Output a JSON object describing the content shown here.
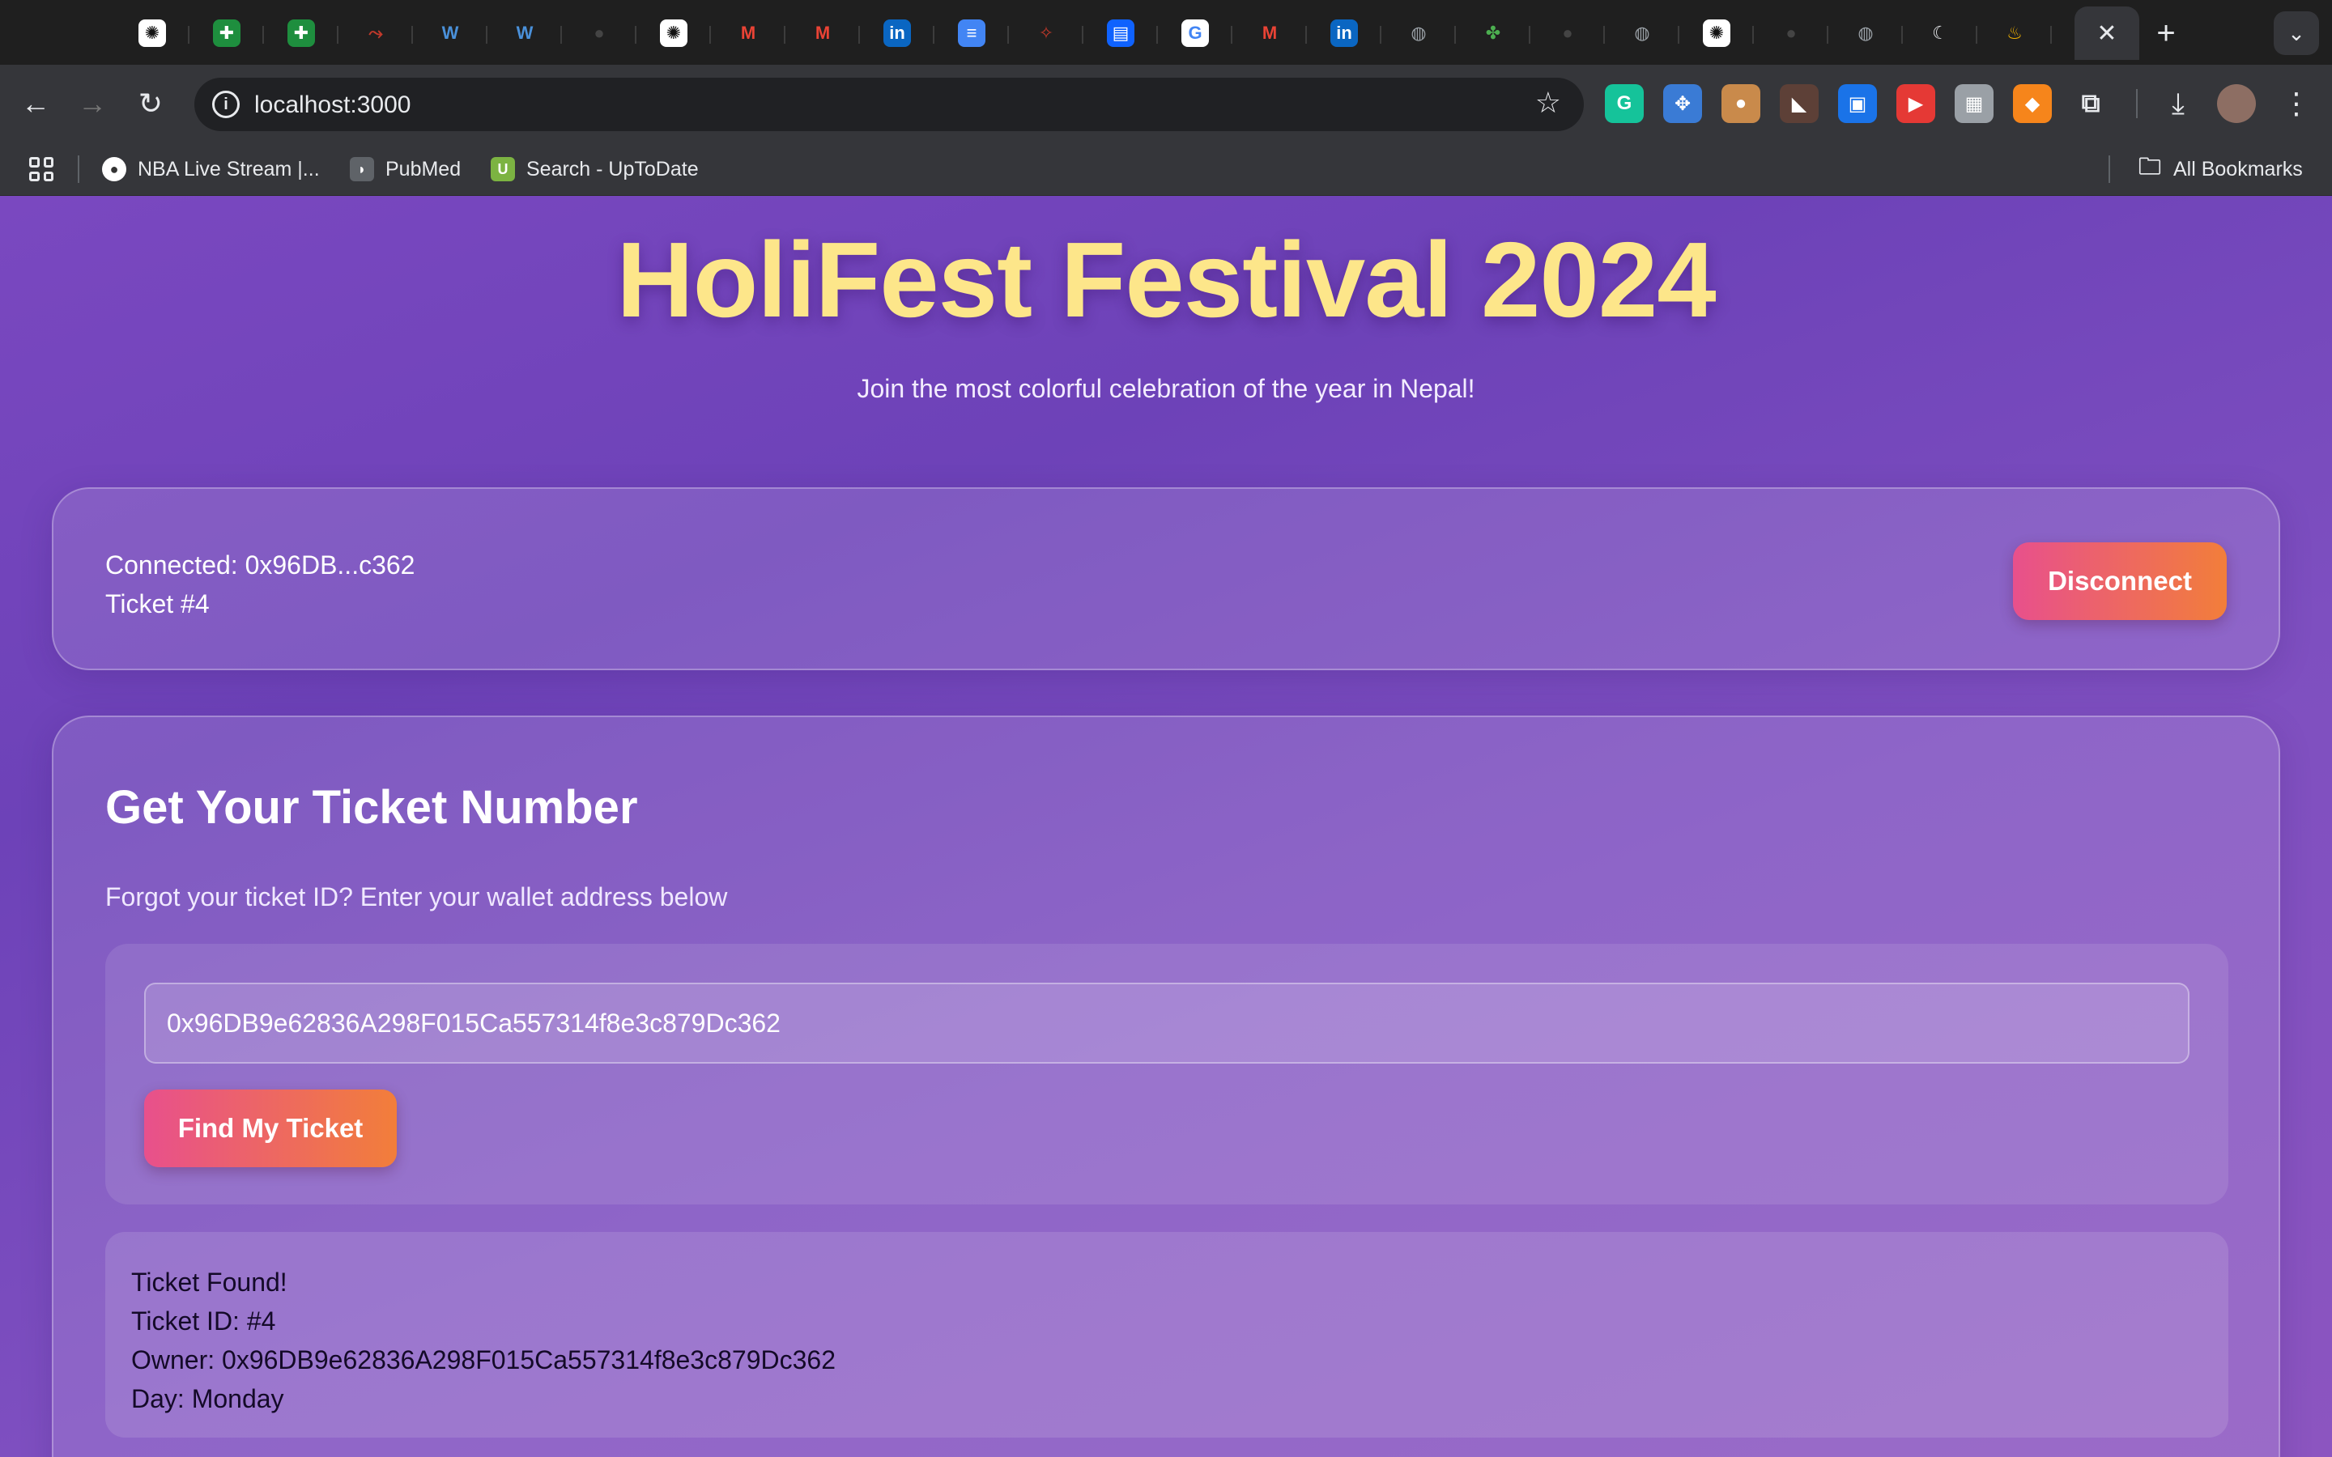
{
  "browser": {
    "tabs": [
      {
        "icon": "chatgpt-icon",
        "glyph": "✺",
        "bg": "#ffffff",
        "fg": "#111"
      },
      {
        "icon": "sheets-icon",
        "glyph": "✚",
        "bg": "#1e8e3e",
        "fg": "#fff"
      },
      {
        "icon": "sheets-icon",
        "glyph": "✚",
        "bg": "#1e8e3e",
        "fg": "#fff"
      },
      {
        "icon": "arrow-icon",
        "glyph": "⤳",
        "bg": "transparent",
        "fg": "#c0392b"
      },
      {
        "icon": "w-icon",
        "glyph": "W",
        "bg": "transparent",
        "fg": "#4a90d9"
      },
      {
        "icon": "w-icon",
        "glyph": "W",
        "bg": "transparent",
        "fg": "#4a90d9"
      },
      {
        "icon": "github-icon",
        "glyph": "●",
        "bg": "transparent",
        "fg": "#444"
      },
      {
        "icon": "chatgpt-icon",
        "glyph": "✺",
        "bg": "#ffffff",
        "fg": "#111"
      },
      {
        "icon": "gmail-icon",
        "glyph": "M",
        "bg": "transparent",
        "fg": "#ea4335"
      },
      {
        "icon": "gmail-icon",
        "glyph": "M",
        "bg": "transparent",
        "fg": "#ea4335"
      },
      {
        "icon": "linkedin-icon",
        "glyph": "in",
        "bg": "#0a66c2",
        "fg": "#fff"
      },
      {
        "icon": "docs-icon",
        "glyph": "≡",
        "bg": "#4285f4",
        "fg": "#fff"
      },
      {
        "icon": "red-logo-icon",
        "glyph": "✧",
        "bg": "transparent",
        "fg": "#c0392b"
      },
      {
        "icon": "ibm-icon",
        "glyph": "▤",
        "bg": "#0f62fe",
        "fg": "#fff"
      },
      {
        "icon": "google-icon",
        "glyph": "G",
        "bg": "#ffffff",
        "fg": "#4285f4"
      },
      {
        "icon": "gmail-icon",
        "glyph": "M",
        "bg": "transparent",
        "fg": "#ea4335"
      },
      {
        "icon": "linkedin-icon",
        "glyph": "in",
        "bg": "#0a66c2",
        "fg": "#fff"
      },
      {
        "icon": "globe-icon",
        "glyph": "◍",
        "bg": "transparent",
        "fg": "#9aa0a6"
      },
      {
        "icon": "clover-icon",
        "glyph": "✤",
        "bg": "transparent",
        "fg": "#4caf50"
      },
      {
        "icon": "github-icon",
        "glyph": "●",
        "bg": "transparent",
        "fg": "#444"
      },
      {
        "icon": "globe-icon",
        "glyph": "◍",
        "bg": "transparent",
        "fg": "#9aa0a6"
      },
      {
        "icon": "chatgpt-icon",
        "glyph": "✺",
        "bg": "#ffffff",
        "fg": "#111"
      },
      {
        "icon": "github-icon",
        "glyph": "●",
        "bg": "transparent",
        "fg": "#444"
      },
      {
        "icon": "globe-icon",
        "glyph": "◍",
        "bg": "transparent",
        "fg": "#9aa0a6"
      },
      {
        "icon": "moon-icon",
        "glyph": "☾",
        "bg": "transparent",
        "fg": "#e8eaed"
      },
      {
        "icon": "flame-icon",
        "glyph": "♨",
        "bg": "transparent",
        "fg": "#f4b400"
      }
    ],
    "active_tab_close": "✕",
    "new_tab": "+",
    "tab_search": "⌄",
    "back": "←",
    "forward": "→",
    "reload": "↻",
    "site_info": "i",
    "url": "localhost:3000",
    "bookmark_star": "☆",
    "extensions": [
      {
        "icon": "grammarly-icon",
        "glyph": "G",
        "bg": "#15c39a"
      },
      {
        "icon": "puzzle-blue-icon",
        "glyph": "✥",
        "bg": "#3a7bd5"
      },
      {
        "icon": "cookie-icon",
        "glyph": "●",
        "bg": "#c98a4b"
      },
      {
        "icon": "shoe-icon",
        "glyph": "◣",
        "bg": "#5d4037"
      },
      {
        "icon": "screenshot-icon",
        "glyph": "▣",
        "bg": "#1a73e8"
      },
      {
        "icon": "youtube-icon",
        "glyph": "▶",
        "bg": "#e53935"
      },
      {
        "icon": "qr-icon",
        "glyph": "▦",
        "bg": "#9aa0a6"
      },
      {
        "icon": "metamask-icon",
        "glyph": "◆",
        "bg": "#f6851b"
      },
      {
        "icon": "extensions-puzzle-icon",
        "glyph": "⧉",
        "bg": "transparent"
      }
    ],
    "download": "⤓",
    "menu": "⋮",
    "bookmarks": [
      {
        "label": "NBA Live Stream |...",
        "icon": "nba-icon",
        "glyph": "●",
        "bg": "#ffffff",
        "fg": "#333"
      },
      {
        "label": "PubMed",
        "icon": "pubmed-icon",
        "glyph": "◗",
        "bg": "#5f6368",
        "fg": "#fff"
      },
      {
        "label": "Search - UpToDate",
        "icon": "uptodate-icon",
        "glyph": "U",
        "bg": "#7cb342",
        "fg": "#fff"
      }
    ],
    "all_bookmarks": "All Bookmarks",
    "all_bookmarks_icon": "🗀"
  },
  "page": {
    "title": "HoliFest Festival 2024",
    "subtitle": "Join the most colorful celebration of the year in Nepal!",
    "connection": {
      "connected": "Connected: 0x96DB...c362",
      "ticket": "Ticket #4",
      "disconnect_label": "Disconnect"
    },
    "lookup": {
      "title": "Get Your Ticket Number",
      "subtitle": "Forgot your ticket ID? Enter your wallet address below",
      "input_value": "0x96DB9e62836A298F015Ca557314f8e3c879Dc362",
      "button_label": "Find My Ticket",
      "result": {
        "heading": "Ticket Found!",
        "ticket_id": "Ticket ID: #4",
        "owner": "Owner: 0x96DB9e62836A298F015Ca557314f8e3c879Dc362",
        "day": "Day: Monday"
      }
    }
  },
  "colors": {
    "title": "#fde68a",
    "gradient_start": "#e8508c",
    "gradient_end": "#f27e3a",
    "background": "#7a48c0"
  }
}
